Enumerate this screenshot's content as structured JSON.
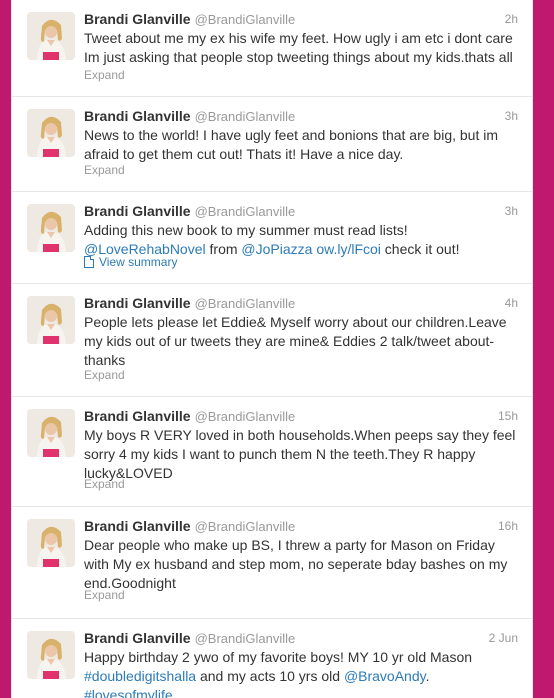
{
  "user": {
    "fullname": "Brandi Glanville",
    "username": "@BrandiGlanville"
  },
  "expand_label": "Expand",
  "summary_label": "View summary",
  "colors": {
    "page_background": "#c0186e",
    "link": "#2b7bb9",
    "meta_text": "#999999"
  },
  "tweets": [
    {
      "time": "2h",
      "lines": [
        "Tweet about me my ex his wife my feet. How ugly i am etc i dont care",
        "Im just asking that people stop tweeting things about my kids.thats all"
      ]
    },
    {
      "time": "3h",
      "lines": [
        "News to the world! I have ugly feet and bonions that are big, but im",
        "afraid to get them cut out! Thats it! Have a nice day."
      ]
    },
    {
      "time": "3h",
      "line1": "Adding this new book to my summer must read lists!",
      "mention1": "@LoveRehabNovel",
      "from": " from ",
      "mention2": "@JoPiazza",
      "link": "ow.ly/lFcoi",
      "end": " check it out!"
    },
    {
      "time": "4h",
      "lines": [
        "People lets please let Eddie& Myself worry about our children.Leave",
        "my kids out of ur tweets they are mine& Eddies 2 talk/tweet about-",
        "thanks"
      ]
    },
    {
      "time": "15h",
      "lines": [
        "My boys R VERY loved in both households.When peeps say they feel",
        "sorry 4 my kids I want to punch them N the teeth.They R happy",
        "lucky&LOVED"
      ]
    },
    {
      "time": "16h",
      "lines": [
        "Dear people who make up BS, I threw a party for Mason on Friday",
        "with My ex husband and step mom, no seperate bday bashes on my",
        "end.Goodnight"
      ]
    },
    {
      "time": "2 Jun",
      "line1": "Happy birthday 2 ywo of my favorite boys! MY 10 yr old Mason",
      "hashtag1": "#doubledigitshalla",
      "mid": " and my acts 10 yrs old ",
      "mention": "@BravoAndy",
      "dot": ".",
      "hashtag2": "#lovesofmylife"
    }
  ]
}
